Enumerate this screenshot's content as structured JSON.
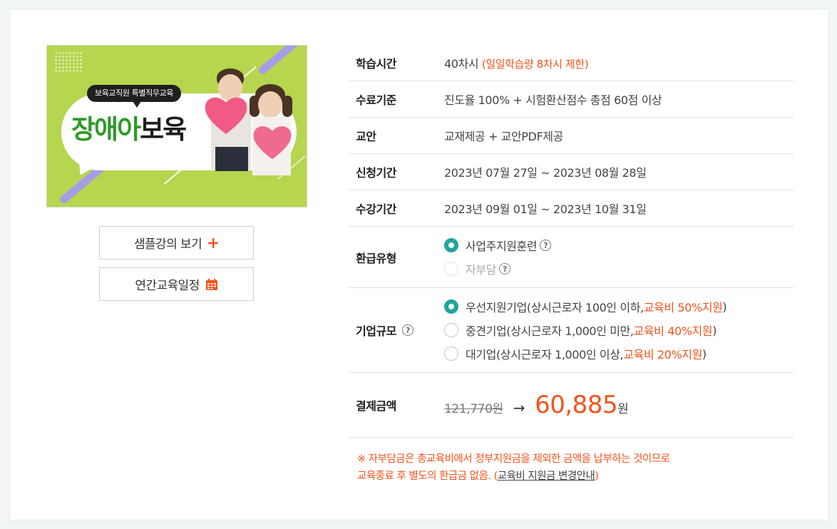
{
  "thumbnail": {
    "tag": "보육교직원 특별직무교육",
    "title_green": "장애아",
    "title_black": "보육"
  },
  "buttons": {
    "sample": "샘플강의 보기",
    "schedule": "연간교육일정"
  },
  "rows": {
    "study_time": {
      "label": "학습시간",
      "value": "40차시",
      "note": "(일일학습량 8차시 제한)"
    },
    "completion": {
      "label": "수료기준",
      "value": "진도율 100% + 시험환산점수 총점 60점 이상"
    },
    "textbook": {
      "label": "교안",
      "value": "교재제공 + 교안PDF제공"
    },
    "apply_period": {
      "label": "신청기간",
      "value": "2023년 07월 27일 ~ 2023년 08월 28일"
    },
    "course_period": {
      "label": "수강기간",
      "value": "2023년 09월 01일 ~ 2023년 10월 31일"
    },
    "refund_type": {
      "label": "환급유형",
      "options": [
        {
          "label": "사업주지원훈련",
          "selected": true,
          "disabled": false
        },
        {
          "label": "자부담",
          "selected": false,
          "disabled": true
        }
      ]
    },
    "company_size": {
      "label": "기업규모",
      "options": [
        {
          "label": "우선지원기업(상시근로자 100인 이하, ",
          "highlight": "교육비 50%지원",
          "close": ")",
          "selected": true
        },
        {
          "label": "중견기업(상시근로자 1,000인 미만, ",
          "highlight": "교육비 40%지원",
          "close": ")",
          "selected": false
        },
        {
          "label": "대기업(상시근로자 1,000인 이상, ",
          "highlight": "교육비 20%지원",
          "close": ")",
          "selected": false
        }
      ]
    },
    "payment": {
      "label": "결제금액",
      "original": "121,770원",
      "arrow": "→",
      "final": "60,885",
      "unit": "원"
    }
  },
  "notice": {
    "line1": "※ 자부담금은 총교육비에서 정부지원금을 제외한 금액을 납부하는 것이므로",
    "line2_prefix": "교육종료 후 별도의 환급금 없음. (",
    "link": "교육비 지원금 변경안내",
    "line2_suffix": ")"
  },
  "colors": {
    "accent": "#f0531c",
    "radio_on": "#1fa79c",
    "thumb_bg": "#b6d64f"
  }
}
